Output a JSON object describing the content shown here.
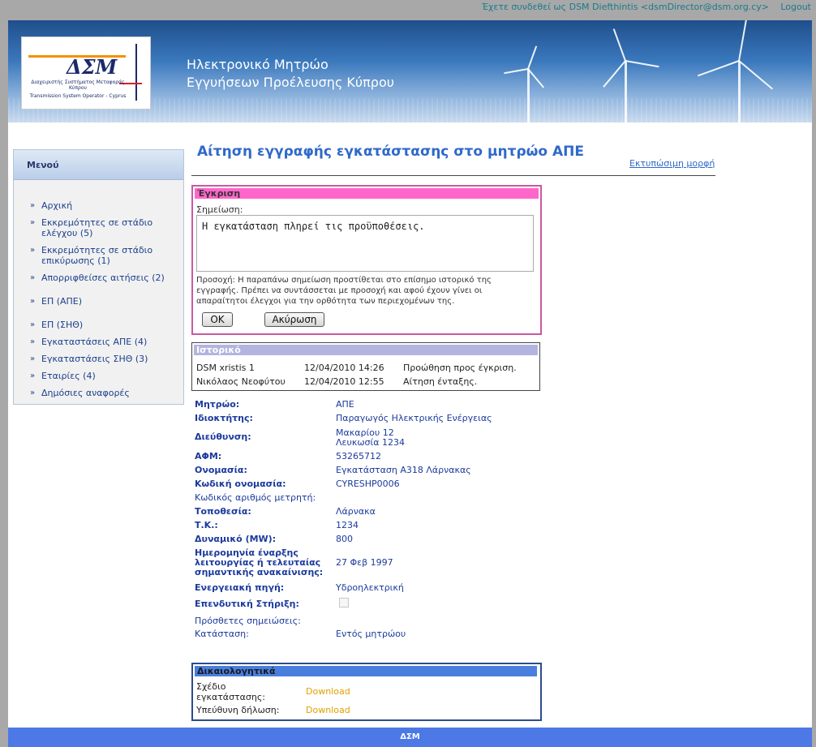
{
  "topbar": {
    "login_text": "Έχετε συνδεθεί ως DSM Diefthintis <dsmDirector@dsm.org.cy>",
    "logout": "Logout"
  },
  "header": {
    "title_line1": "Ηλεκτρονικό Μητρώο",
    "title_line2": "Εγγυήσεων Προέλευσης Κύπρου",
    "logo_letters": "ΔΣΜ",
    "logo_sub1": "Διαχειριστής Συστήματος Μεταφοράς Κύπρου",
    "logo_sub2": "Transmission System Operator - Cyprus"
  },
  "sidebar": {
    "heading": "Μενού",
    "items": [
      {
        "label": "Αρχική"
      },
      {
        "label": "Εκκρεμότητες σε στάδιο ελέγχου (5)"
      },
      {
        "label": "Εκκρεμότητες σε στάδιο επικύρωσης (1)"
      },
      {
        "label": "Απορριφθείσες αιτήσεις (2)"
      },
      {
        "label": "ΕΠ (ΑΠΕ)"
      },
      {
        "label": "ΕΠ (ΣΗΘ)"
      },
      {
        "label": "Εγκαταστάσεις ΑΠΕ (4)"
      },
      {
        "label": "Εγκαταστάσεις ΣΗΘ (3)"
      },
      {
        "label": "Εταιρίες (4)"
      },
      {
        "label": "Δημόσιες αναφορές"
      }
    ]
  },
  "main": {
    "title": "Αίτηση εγγραφής εγκατάστασης στο μητρώο ΑΠΕ",
    "print_link": "Εκτυπώσιμη μορφή"
  },
  "approval": {
    "heading": "Έγκριση",
    "note_label": "Σημείωση:",
    "note_value": "Η εγκατάσταση πληρεί τις προϋποθέσεις.",
    "warning": "Προσοχή: Η παραπάνω σημείωση προστίθεται στο επίσημο ιστορικό της εγγραφής. Πρέπει να συντάσσεται με προσοχή και αφού έχουν γίνει οι απαραίτητοι έλεγχοι για την ορθότητα των περιεχομένων της.",
    "ok_label": "OK",
    "cancel_label": "Ακύρωση"
  },
  "history": {
    "heading": "Ιστορικό",
    "rows": [
      {
        "user": "DSM xristis 1",
        "date": "12/04/2010 14:26",
        "action": "Προώθηση προς έγκριση."
      },
      {
        "user": "Νικόλαος Νεοφύτου",
        "date": "12/04/2010 12:55",
        "action": "Αίτηση ένταξης."
      }
    ]
  },
  "fields": {
    "registry_label": "Μητρώο:",
    "registry_value": "ΑΠΕ",
    "owner_label": "Ιδιοκτήτης:",
    "owner_value": "Παραγωγός Ηλεκτρικής Ενέργειας",
    "address_label": "Διεύθυνση:",
    "address_line1": "Μακαρίου 12",
    "address_line2": "Λευκωσία 1234",
    "afm_label": "ΑΦΜ:",
    "afm_value": "53265712",
    "name_label": "Ονομασία:",
    "name_value": "Εγκατάσταση Α318 Λάρνακας",
    "code_name_label": "Κωδική ονομασία:",
    "code_name_value": "CYRESHP0006",
    "meter_label": "Κωδικός αριθμός μετρητή:",
    "location_label": "Τοποθεσία:",
    "location_value": "Λάρνακα",
    "postcode_label": "Τ.Κ.:",
    "postcode_value": "1234",
    "capacity_label": "Δυναμικό (MW):",
    "capacity_value": "800",
    "date_label_1": "Ημερομηνία έναρξης",
    "date_label_2": "λειτουργίας ή τελευταίας",
    "date_label_3": "σημαντικής ανακαίνισης:",
    "date_value": "27 Φεβ 1997",
    "source_label": "Ενεργειακή πηγή:",
    "source_value": "Υδροηλεκτρική",
    "support_label": "Επενδυτική Στήριξη:",
    "notes_label": "Πρόσθετες σημειώσεις:",
    "status_label": "Κατάσταση:",
    "status_value": "Εντός μητρώου"
  },
  "docs": {
    "heading": "Δικαιολογητικά",
    "plan_label_1": "Σχέδιο",
    "plan_label_2": "εγκατάστασης:",
    "plan_link": "Download",
    "declaration_label": "Υπεύθυνη δήλωση:",
    "declaration_link": "Download"
  },
  "footer": {
    "text": "ΔΣΜ"
  }
}
